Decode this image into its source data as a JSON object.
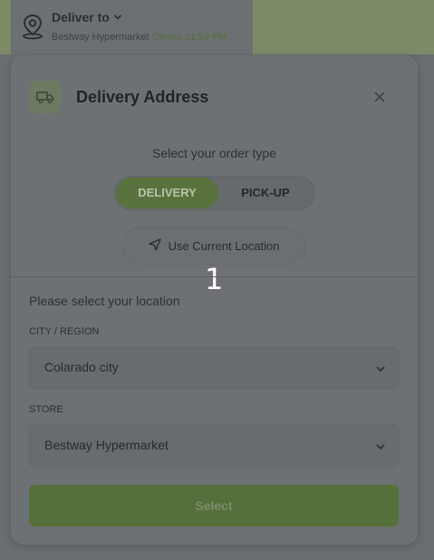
{
  "header": {
    "deliver_to_label": "Deliver to",
    "store_name": "Bestway Hypermarket",
    "closes_text": "Closes 11:59 PM"
  },
  "modal": {
    "title": "Delivery Address",
    "order_type_label": "Select your order type",
    "order_types": {
      "delivery": "DELIVERY",
      "pickup": "PICK-UP"
    },
    "selected_order_type": "DELIVERY",
    "current_location_label": "Use Current Location",
    "step_number": "1",
    "select_location_label": "Please select your location",
    "city": {
      "label": "CITY / REGION",
      "value": "Colarado city"
    },
    "store": {
      "label": "STORE",
      "value": "Bestway Hypermarket"
    },
    "submit_label": "Select"
  },
  "colors": {
    "accent": "#5a733e",
    "overlay": "#6d7173"
  },
  "icons": {
    "location": "map-pin-icon",
    "dropdown": "chevron-down-icon",
    "truck": "truck-icon",
    "close": "close-icon",
    "navigate": "navigation-arrow-icon"
  }
}
